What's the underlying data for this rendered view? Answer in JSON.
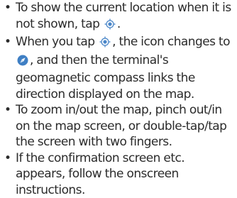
{
  "bullet_char": "•",
  "icons": {
    "location": {
      "name": "current-location-icon",
      "color": "#4a86c8"
    },
    "compass": {
      "name": "compass-mode-icon",
      "color": "#3f7fc4"
    }
  },
  "items": [
    {
      "before": "To show the current location when it is not shown, tap ",
      "after": "."
    },
    {
      "before": "When you tap ",
      "middle": ", the icon changes to ",
      "after": ", and then the terminal's geomagnetic compass links the direction displayed on the map."
    },
    {
      "text": "To zoom in/out the map, pinch out/in on the map screen, or double-tap/tap the screen with two fingers."
    },
    {
      "text": "If the confirmation screen etc. appears, follow the onscreen instructions."
    }
  ]
}
